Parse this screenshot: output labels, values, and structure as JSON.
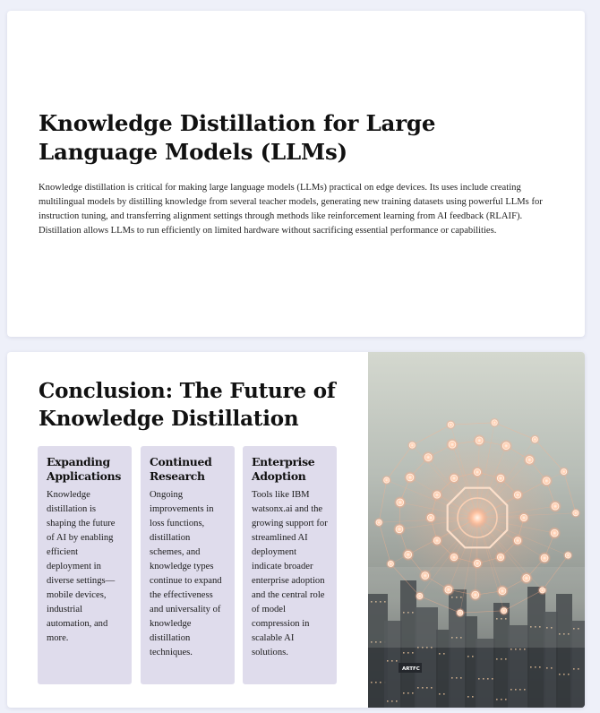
{
  "slide1": {
    "title": "Knowledge Distillation for Large Language Models (LLMs)",
    "body": "Knowledge distillation is critical for making large language models (LLMs) practical on edge devices. Its uses include creating multilingual models by distilling knowledge from several teacher models, generating new training datasets using powerful LLMs for instruction tuning, and transferring alignment settings through methods like reinforcement learning from AI feedback (RLAIF). Distillation allows LLMs to run efficiently on limited hardware without sacrificing essential performance or capabilities."
  },
  "slide2": {
    "title": "Conclusion: The Future of Knowledge Distillation",
    "cards": [
      {
        "title": "Expanding Applications",
        "body": "Knowledge distillation is shaping the future of AI by enabling efficient deployment in diverse settings—mobile devices, industrial automation, and more."
      },
      {
        "title": "Continued Research",
        "body": "Ongoing improvements in loss functions, distillation schemes, and knowledge types continue to expand the effectiveness and universality of knowledge distillation techniques."
      },
      {
        "title": "Enterprise Adoption",
        "body": "Tools like IBM watsonx.ai and the growing support for streamlined AI deployment indicate broader enterprise adoption and the central role of model compression in scalable AI solutions."
      }
    ],
    "image": {
      "sign_text": "ARTFC",
      "glow_color": "#ffb08a"
    }
  }
}
